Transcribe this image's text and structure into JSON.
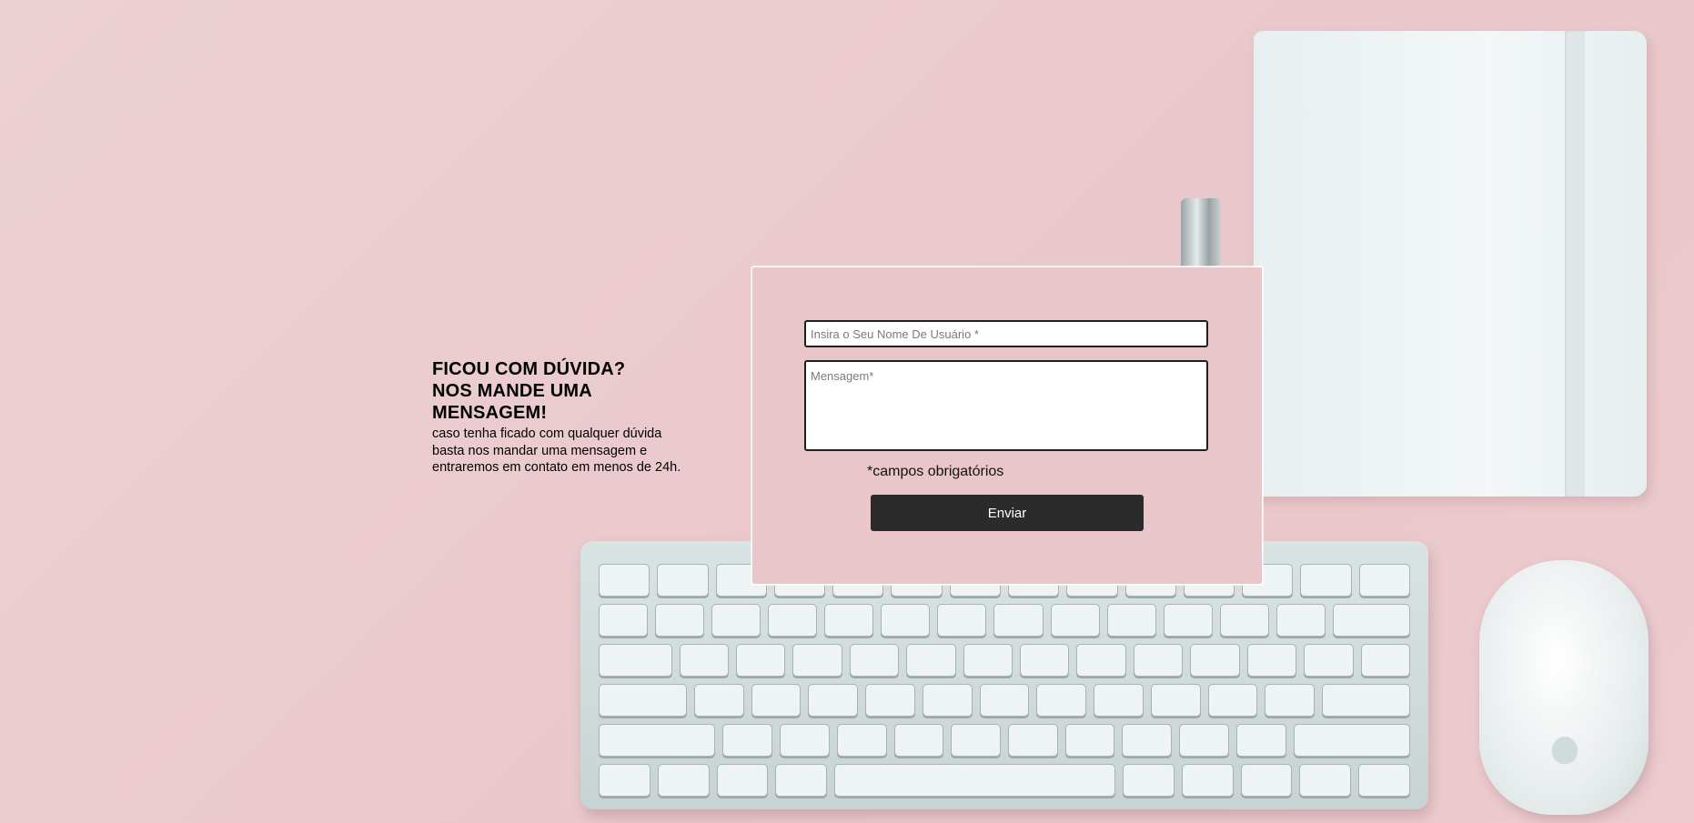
{
  "intro": {
    "heading_lines": [
      "FICOU COM DÚVIDA?",
      "NOS MANDE UMA",
      "MENSAGEM!"
    ],
    "body_lines": [
      "caso tenha ficado com qualquer dúvida",
      "basta nos mandar uma mensagem e",
      "entraremos em contato em menos de 24h."
    ]
  },
  "form": {
    "name_placeholder": "Insira o Seu Nome De Usuário *",
    "name_value": "",
    "message_placeholder": "Mensagem*",
    "message_value": "",
    "required_note": "*campos obrigatórios",
    "submit_label": "Enviar"
  },
  "colors": {
    "background": "#ecccd0",
    "card": "#e9c6c9",
    "button": "#2b2b2b"
  },
  "icons": [
    "notebook-image",
    "pen-image",
    "keyboard-image",
    "mouse-image"
  ]
}
